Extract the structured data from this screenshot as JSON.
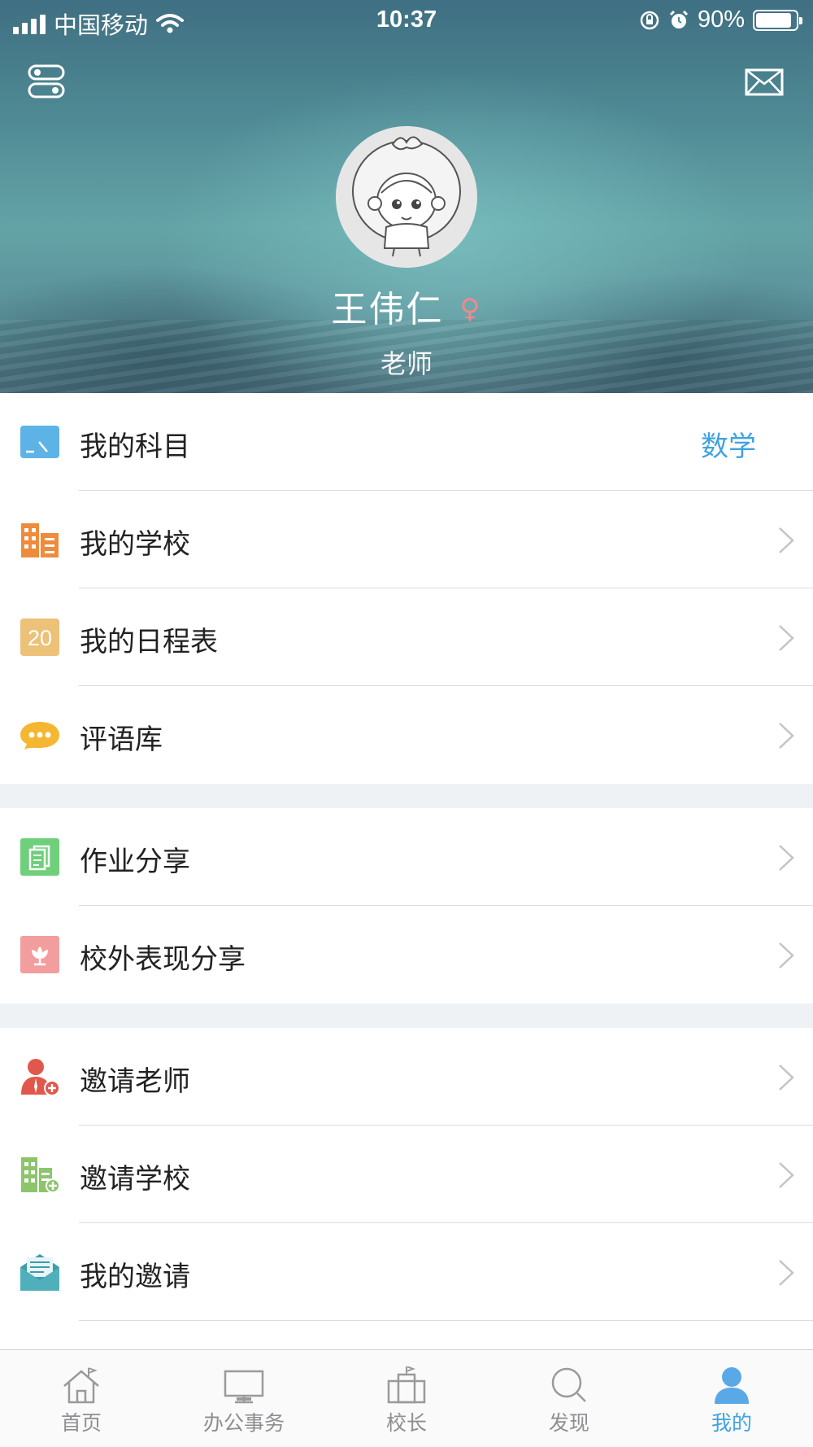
{
  "status_bar": {
    "carrier": "中国移动",
    "time": "10:37",
    "battery": "90%",
    "battery_level": 0.9
  },
  "header": {
    "name": "王伟仁",
    "gender_symbol": "♀",
    "role": "老师",
    "left_icon": "toggle-settings-icon",
    "right_icon": "mail-icon"
  },
  "menu": {
    "subject": {
      "label": "我的科目",
      "value": "数学",
      "icon": "tablet-icon"
    },
    "school": {
      "label": "我的学校",
      "icon": "building-icon"
    },
    "schedule": {
      "label": "我的日程表",
      "icon": "calendar-icon",
      "icon_text": "20"
    },
    "comments": {
      "label": "评语库",
      "icon": "chat-bubble-icon"
    },
    "homework": {
      "label": "作业分享",
      "icon": "document-icon"
    },
    "outside": {
      "label": "校外表现分享",
      "icon": "flower-icon"
    },
    "invite_teacher": {
      "label": "邀请老师",
      "icon": "add-user-icon"
    },
    "invite_school": {
      "label": "邀请学校",
      "icon": "add-building-icon"
    },
    "my_invites": {
      "label": "我的邀请",
      "icon": "envelope-icon"
    }
  },
  "tabs": [
    {
      "label": "首页",
      "icon": "home-icon",
      "active": false
    },
    {
      "label": "办公事务",
      "icon": "monitor-icon",
      "active": false
    },
    {
      "label": "校长",
      "icon": "principal-icon",
      "active": false
    },
    {
      "label": "发现",
      "icon": "search-icon",
      "active": false
    },
    {
      "label": "我的",
      "icon": "person-icon",
      "active": true
    }
  ],
  "colors": {
    "accent": "#3ea3e0",
    "tab_inactive": "#8e8e93",
    "gender": "#f08a8a",
    "section_gap": "#eff2f5"
  }
}
